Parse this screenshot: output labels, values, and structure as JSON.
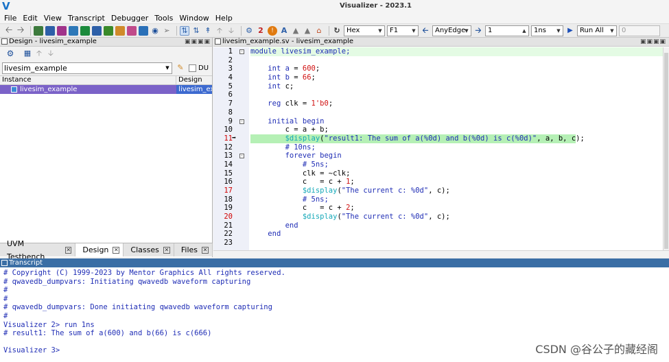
{
  "app": {
    "title": "Visualizer - 2023.1"
  },
  "menu": [
    "File",
    "Edit",
    "View",
    "Transcript",
    "Debugger",
    "Tools",
    "Window",
    "Help"
  ],
  "toolbar": {
    "radix": "Hex",
    "key": "F1",
    "edge": "AnyEdge",
    "step_count": "1",
    "step_unit": "1ns",
    "run": "Run All",
    "run_value": "0"
  },
  "design_panel": {
    "title": "Design - livesim_example",
    "search_value": "livesim_example",
    "du_label": "DU",
    "columns": [
      "Instance",
      "Design Ur"
    ],
    "rows": [
      {
        "instance": "livesim_example",
        "design_unit": "livesim_ex"
      }
    ],
    "tabs": [
      "UVM Testbench",
      "Design",
      "Classes",
      "Files"
    ]
  },
  "source": {
    "tab_title": "livesim_example.sv - livesim_example",
    "breakpoint_line": "11"
  },
  "transcript": {
    "title": "Transcript",
    "lines": [
      "# Copyright (C) 1999-2023 by Mentor Graphics All rights reserved.",
      "# qwavedb_dumpvars: Initiating qwavedb waveform capturing",
      "#",
      "#",
      "# qwavedb_dumpvars: Done initiating qwavedb waveform capturing",
      "#",
      "Visualizer 2> run 1ns",
      "# result1: The sum of a(600) and b(66) is c(666)",
      "",
      "Visualizer 3>"
    ]
  },
  "watermark": "CSDN @谷公子的藏经阁",
  "colors": {
    "selection": "#7b62c8",
    "current_line": "#b5f0b5",
    "transcript_header": "#3a6ea5"
  }
}
